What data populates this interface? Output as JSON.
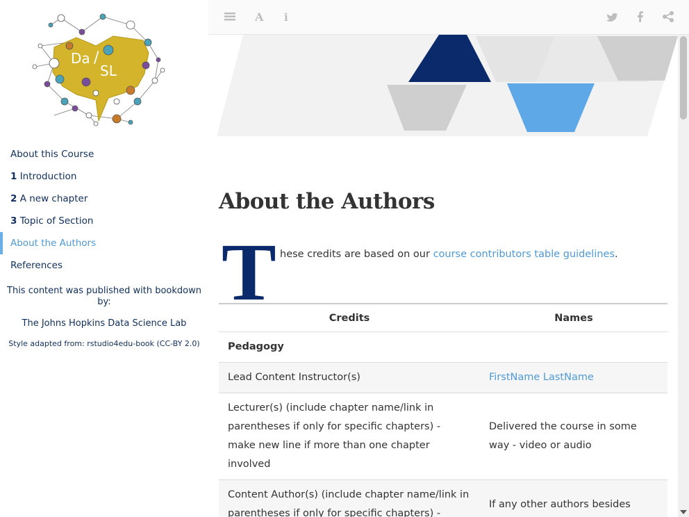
{
  "sidebar": {
    "logo_text": "Da/SL",
    "items": [
      {
        "num": "",
        "label": "About this Course",
        "active": false
      },
      {
        "num": "1",
        "label": "Introduction",
        "active": false
      },
      {
        "num": "2",
        "label": "A new chapter",
        "active": false
      },
      {
        "num": "3",
        "label": "Topic of Section",
        "active": false
      },
      {
        "num": "",
        "label": "About the Authors",
        "active": true
      },
      {
        "num": "",
        "label": "References",
        "active": false
      }
    ],
    "published_text": "This content was published with bookdown by:",
    "lab_text": "The Johns Hopkins Data Science Lab",
    "style_text": "Style adapted from: rstudio4edu-book (CC-BY 2.0)"
  },
  "toolbar": {
    "left_icons": [
      "menu-icon",
      "font-icon",
      "info-icon"
    ],
    "right_icons": [
      "twitter-icon",
      "facebook-icon",
      "share-icon"
    ]
  },
  "main": {
    "title": "About the Authors",
    "dropcap": "T",
    "intro_text": "hese credits are based on our ",
    "intro_link": "course contributors table guidelines",
    "intro_end": "."
  },
  "table": {
    "headers": [
      "Credits",
      "Names"
    ],
    "rows": [
      {
        "credit": "Pedagogy",
        "name": "",
        "section": true
      },
      {
        "credit": "Lead Content Instructor(s)",
        "name": "FirstName LastName",
        "link": true
      },
      {
        "credit": "Lecturer(s) (include chapter name/link in parentheses if only for specific chapters) - make new line if more than one chapter involved",
        "name": "Delivered the course in some way - video or audio"
      },
      {
        "credit": "Content Author(s) (include chapter name/link in parentheses if only for specific chapters) -",
        "name": "If any other authors besides"
      }
    ]
  },
  "colors": {
    "nav_text": "#0f2e5c",
    "active": "#4e9ad8",
    "dropcap": "#0a2a6b",
    "banner_dark": "#0a2a6b",
    "banner_light": "#5fa8e8",
    "banner_grey": "#cfcfcf"
  }
}
